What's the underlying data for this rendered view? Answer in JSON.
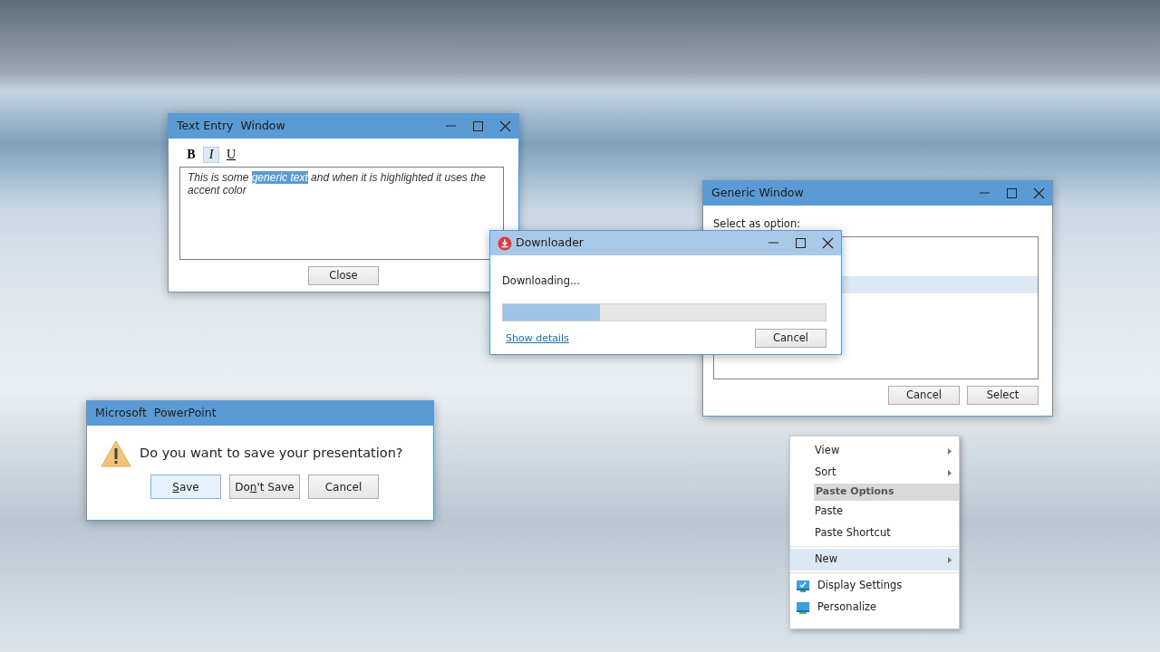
{
  "text_entry_window": {
    "title": "Text Entry  Window",
    "format_buttons": [
      {
        "label": "B",
        "kind": "bold",
        "selected": false
      },
      {
        "label": "I",
        "kind": "italic",
        "selected": true
      },
      {
        "label": "U",
        "kind": "underline",
        "selected": false
      }
    ],
    "text_before": "This is some ",
    "selected_text": "generic text",
    "text_after": " and when it is highlighted it uses the accent color",
    "button": "Close"
  },
  "generic_window": {
    "title": "Generic Window",
    "prompt": "Select as option:",
    "list_rows": [
      {
        "selected": false
      },
      {
        "selected": true
      }
    ],
    "buttons": [
      "Cancel",
      "Select"
    ]
  },
  "downloader_window": {
    "title": "Downloader",
    "status": "Downloading...",
    "progress": {
      "level": 0.3
    },
    "link": "Show details",
    "button": "Cancel"
  },
  "powerpoint_dialog": {
    "title": "Microsoft  PowerPoint",
    "message": "Do you want to save your presentation?",
    "buttons": [
      {
        "label_parts": [
          {
            "text": "S",
            "access_key": true
          },
          {
            "text": "ave",
            "access_key": false
          }
        ],
        "default": true
      },
      {
        "label_parts": [
          {
            "text": "Do",
            "access_key": false
          },
          {
            "text": "n",
            "access_key": true
          },
          {
            "text": "'t Save",
            "access_key": false
          }
        ],
        "default": false
      },
      {
        "label_parts": [
          {
            "text": "Cancel",
            "access_key": false
          }
        ],
        "default": false
      }
    ]
  },
  "context_menu": {
    "items": [
      {
        "kind": "item",
        "label": "View",
        "submenu": true,
        "selected": false
      },
      {
        "kind": "item",
        "label": "Sort",
        "submenu": true,
        "selected": false
      },
      {
        "kind": "header",
        "label": "Paste Options"
      },
      {
        "kind": "item",
        "label": "Paste",
        "submenu": false,
        "selected": false
      },
      {
        "kind": "item",
        "label": "Paste Shortcut",
        "submenu": false,
        "selected": false
      },
      {
        "kind": "separator"
      },
      {
        "kind": "item",
        "label": "New",
        "submenu": true,
        "selected": true
      },
      {
        "kind": "separator"
      },
      {
        "kind": "icon",
        "label": "Display Settings"
      },
      {
        "kind": "icon",
        "label": "Personalize"
      }
    ]
  }
}
